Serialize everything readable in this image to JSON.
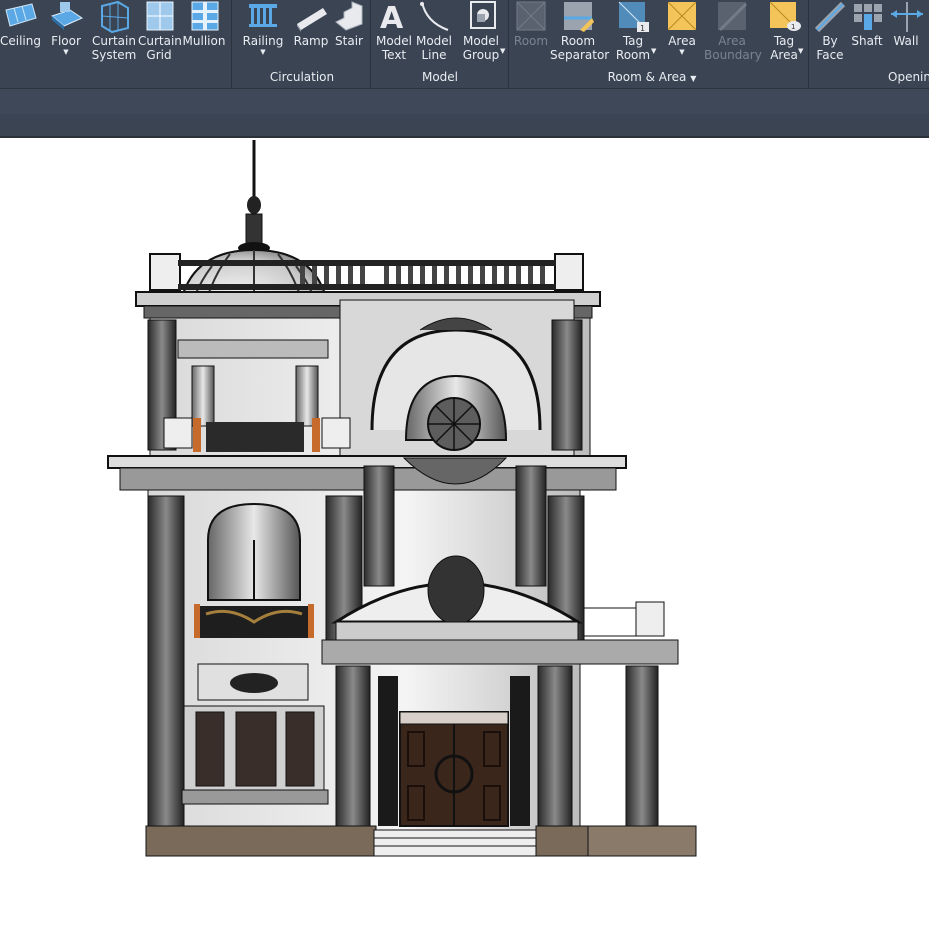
{
  "ribbon": {
    "buttons": [
      {
        "id": "ceiling",
        "label": "Ceiling",
        "disabled": false,
        "icon": "ceiling-icon"
      },
      {
        "id": "floor",
        "label": "Floor",
        "disabled": false,
        "icon": "floor-icon",
        "dropdown": true
      },
      {
        "id": "curtain_system",
        "label": "Curtain\nSystem",
        "disabled": false,
        "icon": "curtain-system-icon"
      },
      {
        "id": "curtain_grid",
        "label": "Curtain\nGrid",
        "disabled": false,
        "icon": "curtain-grid-icon"
      },
      {
        "id": "mullion",
        "label": "Mullion",
        "disabled": false,
        "icon": "mullion-icon"
      },
      {
        "id": "railing",
        "label": "Railing",
        "disabled": false,
        "icon": "railing-icon",
        "dropdown": true
      },
      {
        "id": "ramp",
        "label": "Ramp",
        "disabled": false,
        "icon": "ramp-icon"
      },
      {
        "id": "stair",
        "label": "Stair",
        "disabled": false,
        "icon": "stair-icon"
      },
      {
        "id": "model_text",
        "label": "Model\nText",
        "disabled": false,
        "icon": "model-text-icon"
      },
      {
        "id": "model_line",
        "label": "Model\nLine",
        "disabled": false,
        "icon": "model-line-icon"
      },
      {
        "id": "model_group",
        "label": "Model\nGroup",
        "disabled": false,
        "icon": "model-group-icon",
        "dropdown": true
      },
      {
        "id": "room",
        "label": "Room",
        "disabled": true,
        "icon": "room-icon"
      },
      {
        "id": "room_separator",
        "label": "Room\nSeparator",
        "disabled": false,
        "icon": "room-separator-icon"
      },
      {
        "id": "tag_room",
        "label": "Tag\nRoom",
        "disabled": false,
        "icon": "tag-room-icon",
        "dropdown": true
      },
      {
        "id": "area",
        "label": "Area",
        "disabled": false,
        "icon": "area-icon",
        "dropdown": true
      },
      {
        "id": "area_boundary",
        "label": "Area\nBoundary",
        "disabled": true,
        "icon": "area-boundary-icon"
      },
      {
        "id": "tag_area",
        "label": "Tag\nArea",
        "disabled": false,
        "icon": "tag-area-icon",
        "dropdown": true
      },
      {
        "id": "by_face",
        "label": "By\nFace",
        "disabled": false,
        "icon": "by-face-icon"
      },
      {
        "id": "shaft",
        "label": "Shaft",
        "disabled": false,
        "icon": "shaft-icon"
      },
      {
        "id": "wall",
        "label": "Wall",
        "disabled": false,
        "icon": "wall-opening-icon"
      }
    ],
    "groups": {
      "circulation": "Circulation",
      "model": "Model",
      "room_area": "Room & Area",
      "opening": "Openin"
    }
  },
  "canvas": {
    "drawing": "classical-villa-elevation"
  },
  "colors": {
    "ribbon_bg": "#3b4453",
    "ribbon_text": "#e9edf2",
    "disabled_text": "#7b8390",
    "icon_blue": "#5aa9e6",
    "icon_yellow": "#f3c45a"
  }
}
